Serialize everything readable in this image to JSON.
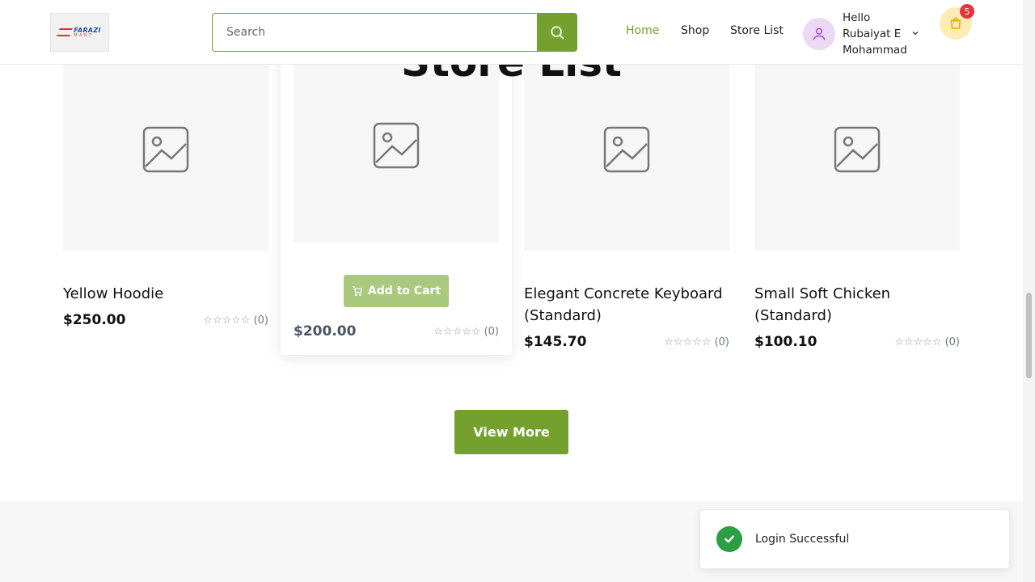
{
  "header": {
    "logo": {
      "line1": "FARAZI",
      "line2": "MART"
    },
    "search_placeholder": "Search",
    "nav": {
      "home": "Home",
      "shop": "Shop",
      "store_list": "Store List"
    },
    "user": {
      "greeting": "Hello Rubaiyat E Mohammad"
    },
    "cart_count": "5",
    "accent_color": "#74a12e"
  },
  "products": [
    {
      "name": "Yellow Hoodie",
      "price": "$250.00",
      "rating": 0,
      "reviews": "(0)"
    },
    {
      "name": "",
      "price": "$200.00",
      "rating": 0,
      "reviews": "(0)",
      "add_to_cart": "Add to Cart"
    },
    {
      "name": "Elegant Concrete Keyboard (Standard)",
      "price": "$145.70",
      "rating": 0,
      "reviews": "(0)"
    },
    {
      "name": "Small Soft Chicken (Standard)",
      "price": "$100.10",
      "rating": 0,
      "reviews": "(0)"
    }
  ],
  "view_more": "View More",
  "store_section": {
    "title": "Store List"
  },
  "toast": {
    "message": "Login Successful",
    "color": "#2c9e44"
  }
}
